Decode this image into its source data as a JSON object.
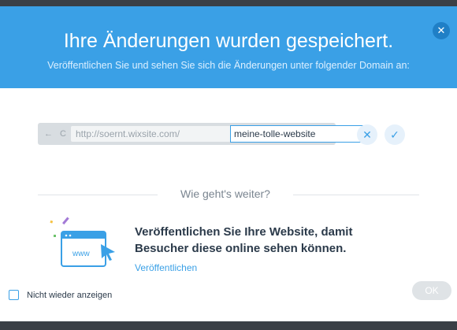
{
  "header": {
    "title": "Ihre Änderungen wurden gespeichert.",
    "subtitle": "Veröffentlichen Sie und sehen Sie sich die Änderungen unter folgender Domain an:",
    "close_icon": "close-icon"
  },
  "domain": {
    "nav_icons": "← C",
    "prefix": "http://soernt.wixsite.com/",
    "value": "meine-tolle-website",
    "cancel_icon": "✕",
    "confirm_icon": "✓"
  },
  "next": {
    "section_title": "Wie geht's weiter?",
    "promo_text": "Veröffentlichen Sie Ihre Website, damit Besucher diese online sehen können.",
    "link_label": "Veröffentlichen",
    "illustration_text": "www"
  },
  "footer": {
    "checkbox_label": "Nicht wieder anzeigen",
    "ok_label": "OK"
  },
  "colors": {
    "accent": "#3aa0e6",
    "header_bg": "#3aa0e6",
    "text_dark": "#2b3a4a"
  }
}
